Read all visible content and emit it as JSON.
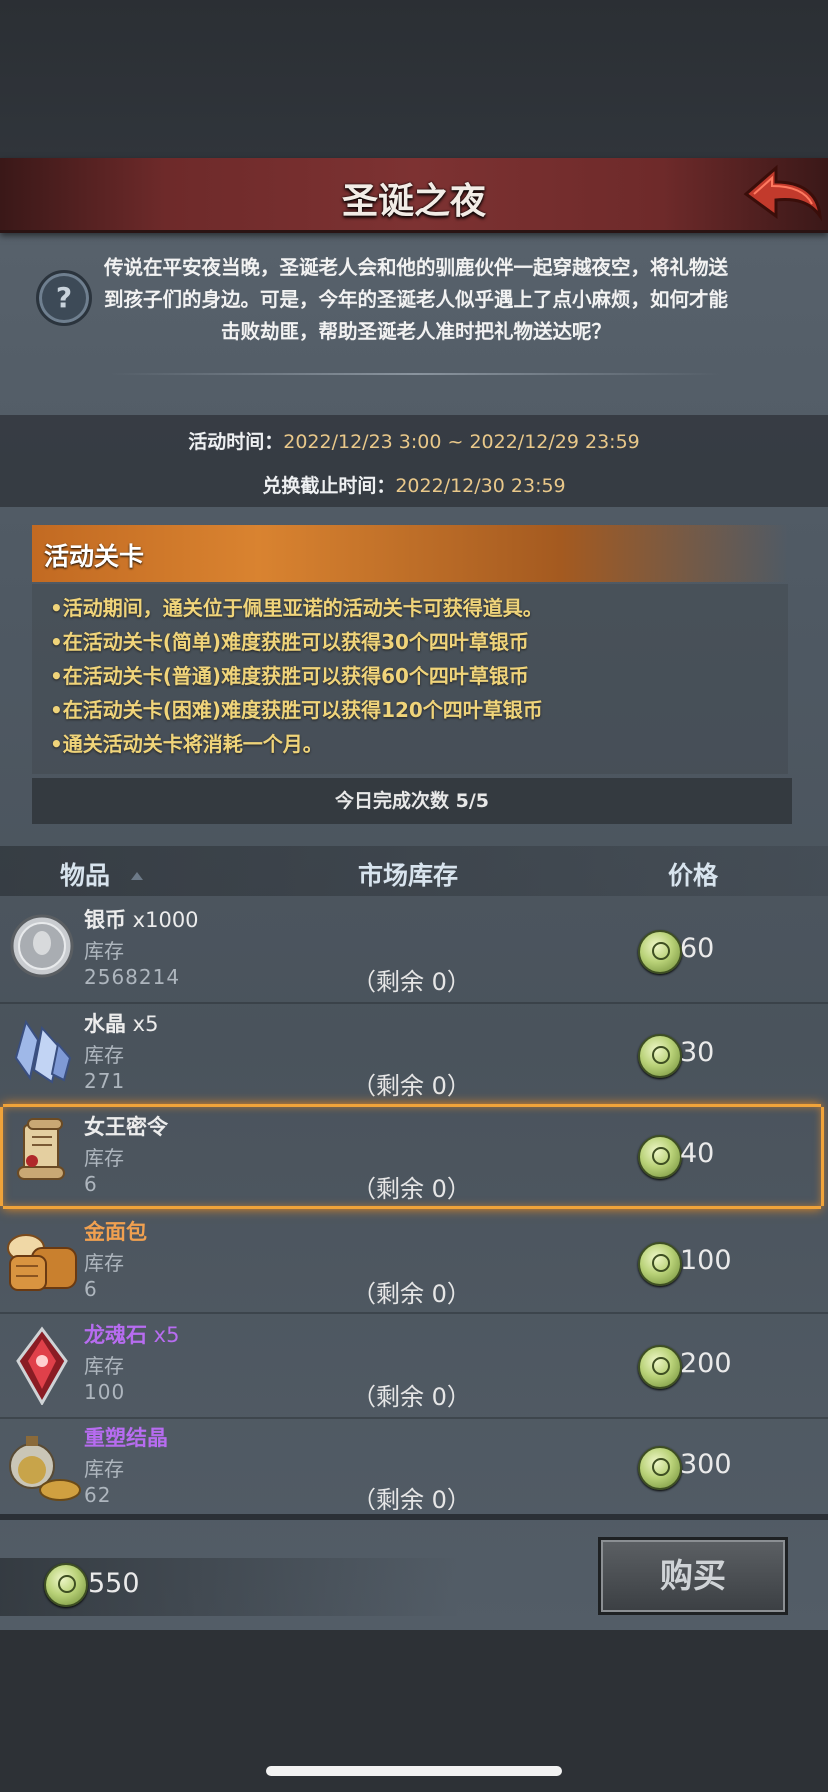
{
  "header": {
    "title": "圣诞之夜"
  },
  "description": "传说在平安夜当晚，圣诞老人会和他的驯鹿伙伴一起穿越夜空，将礼物送到孩子们的身边。可是，今年的圣诞老人似乎遇上了点小麻烦，如何才能击败劫匪，帮助圣诞老人准时把礼物送达呢？",
  "event_time": {
    "label": "活动时间：",
    "value": "2022/12/23 3:00 ~ 2022/12/29 23:59"
  },
  "exchange_deadline": {
    "label": "兑换截止时间：",
    "value": "2022/12/30 23:59"
  },
  "section": {
    "title": "活动关卡",
    "rules": [
      "•活动期间，通关位于佩里亚诺的活动关卡可获得道具。",
      "•在活动关卡(简单)难度获胜可以获得30个四叶草银币",
      "•在活动关卡(普通)难度获胜可以获得60个四叶草银币",
      "•在活动关卡(困难)难度获胜可以获得120个四叶草银币",
      "•通关活动关卡将消耗一个月。"
    ],
    "today_count": "今日完成次数  5/5"
  },
  "table": {
    "headers": {
      "item": "物品",
      "stock": "市场库存",
      "price": "价格"
    },
    "stock_label": "库存",
    "rows": [
      {
        "name": "银币",
        "qty": " x1000",
        "stock": "2568214",
        "remain": "（剩余 0）",
        "price": "60",
        "color": "#ececec"
      },
      {
        "name": "水晶",
        "qty": " x5",
        "stock": "271",
        "remain": "（剩余 0）",
        "price": "30",
        "color": "#ececec"
      },
      {
        "name": "女王密令",
        "qty": "",
        "stock": "6",
        "remain": "（剩余 0）",
        "price": "40",
        "color": "#ececec"
      },
      {
        "name": "金面包",
        "qty": "",
        "stock": "6",
        "remain": "（剩余 0）",
        "price": "100",
        "color": "#f0a050"
      },
      {
        "name": "龙魂石",
        "qty": " x5",
        "stock": "100",
        "remain": "（剩余 0）",
        "price": "200",
        "color": "#b76cf0"
      },
      {
        "name": "重塑结晶",
        "qty": "",
        "stock": "62",
        "remain": "（剩余 0）",
        "price": "300",
        "color": "#b76cf0"
      }
    ]
  },
  "wallet": {
    "balance": "550"
  },
  "buy_button": {
    "label": "购买"
  },
  "colors": {
    "accent_orange": "#f0a33a",
    "legendary_purple": "#b76cf0",
    "rare_orange": "#f0a050",
    "time_value": "#e9c88a"
  }
}
